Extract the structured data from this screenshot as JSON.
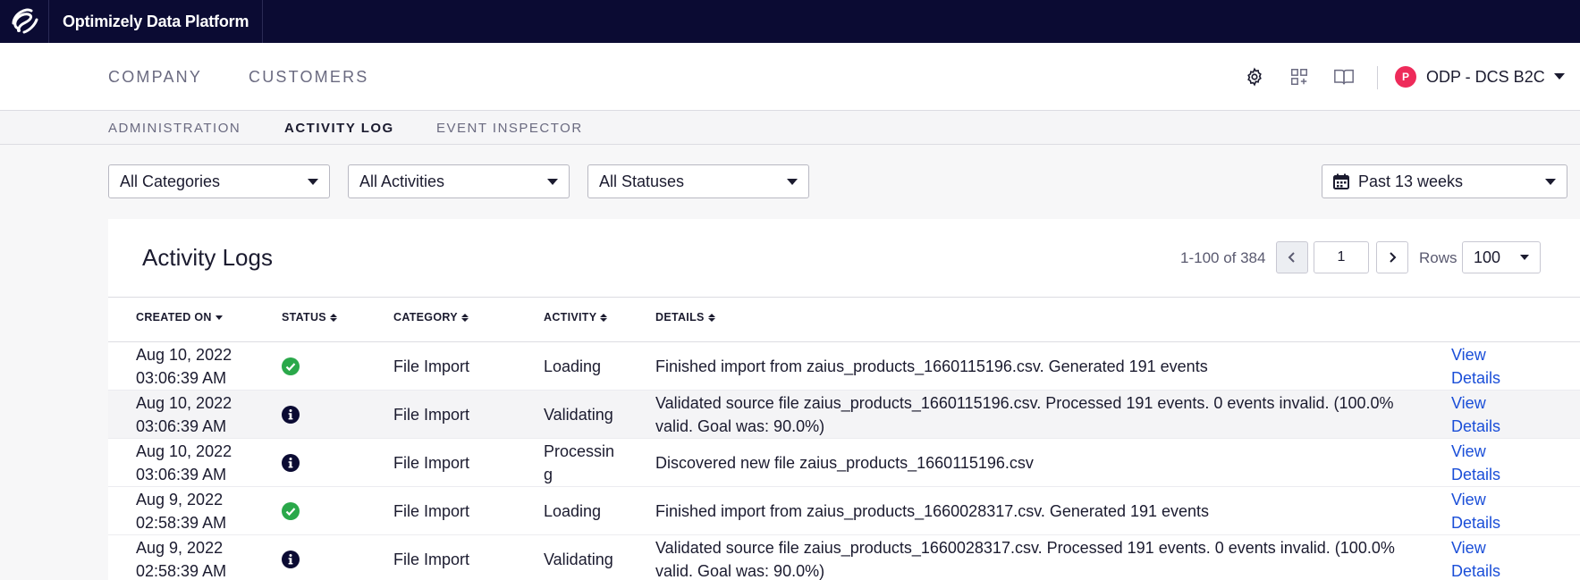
{
  "app": {
    "title": "Optimizely Data Platform",
    "logo_icon": "optimizely-logo-icon"
  },
  "main_nav": {
    "tabs": [
      {
        "label": "COMPANY"
      },
      {
        "label": "CUSTOMERS"
      }
    ]
  },
  "tools": {
    "settings_icon": "gear-icon",
    "apps_icon": "add-app-grid-icon",
    "docs_icon": "book-icon"
  },
  "org": {
    "avatar_letter": "P",
    "name": "ODP - DCS B2C",
    "avatar_color": "#ee2b5a"
  },
  "sub_nav": {
    "tabs": [
      {
        "label": "ADMINISTRATION"
      },
      {
        "label": "ACTIVITY LOG"
      },
      {
        "label": "EVENT INSPECTOR"
      }
    ],
    "active": "ACTIVITY LOG"
  },
  "filters": {
    "categories": "All Categories",
    "activities": "All Activities",
    "statuses": "All Statuses",
    "date_range": "Past 13 weeks"
  },
  "card": {
    "title": "Activity Logs",
    "pager": {
      "range": "1-100 of 384",
      "page": "1",
      "rows_label": "Rows",
      "rows_value": "100"
    }
  },
  "table": {
    "columns": [
      "CREATED ON",
      "STATUS",
      "CATEGORY",
      "ACTIVITY",
      "DETAILS"
    ],
    "rows": [
      {
        "date": "Aug 10, 2022",
        "time": "03:06:39 AM",
        "status": "success",
        "category": "File Import",
        "activity": "Loading",
        "details": "Finished import from zaius_products_1660115196.csv. Generated 191 events",
        "link1": "View",
        "link2": "Details"
      },
      {
        "date": "Aug 10, 2022",
        "time": "03:06:39 AM",
        "status": "info",
        "category": "File Import",
        "activity": "Validating",
        "details": "Validated source file zaius_products_1660115196.csv. Processed 191 events. 0 events invalid. (100.0%",
        "details2": "valid. Goal was: 90.0%)",
        "link1": "View",
        "link2": "Details"
      },
      {
        "date": "Aug 10, 2022",
        "time": "03:06:39 AM",
        "status": "info",
        "category": "File Import",
        "activity": "Processin",
        "activity2": "g",
        "details": "Discovered new file zaius_products_1660115196.csv",
        "link1": "View",
        "link2": "Details"
      },
      {
        "date": "Aug 9, 2022",
        "time": "02:58:39 AM",
        "status": "success",
        "category": "File Import",
        "activity": "Loading",
        "details": "Finished import from zaius_products_1660028317.csv. Generated 191 events",
        "link1": "View",
        "link2": "Details"
      },
      {
        "date": "Aug 9, 2022",
        "time": "02:58:39 AM",
        "status": "info",
        "category": "File Import",
        "activity": "Validating",
        "details": "Validated source file zaius_products_1660028317.csv. Processed 191 events. 0 events invalid. (100.0%",
        "details2": "valid. Goal was: 90.0%)",
        "link1": "View",
        "link2": "Details"
      }
    ]
  },
  "colors": {
    "topbar": "#0b0b33",
    "success": "#2aa84a",
    "info": "#0b0b33",
    "link": "#1a4ed8"
  }
}
